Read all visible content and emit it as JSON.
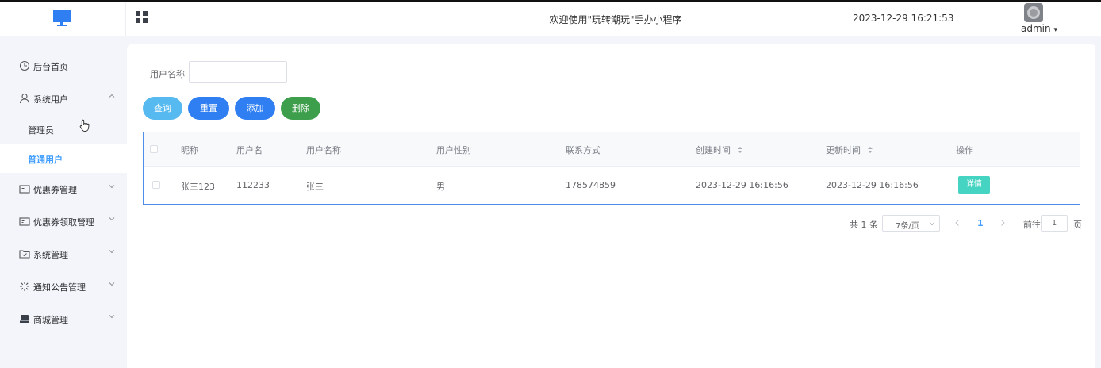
{
  "header": {
    "welcome": "欢迎使用\"玩转潮玩\"手办小程序",
    "datetime": "2023-12-29 16:21:53",
    "user": "admin",
    "user_caret": "▾"
  },
  "sidebar": {
    "items": [
      {
        "label": "后台首页",
        "icon": "clock-icon"
      },
      {
        "label": "系统用户",
        "icon": "user-icon",
        "expanded": true
      },
      {
        "label": "优惠券管理",
        "icon": "coupon-icon"
      },
      {
        "label": "优惠券领取管理",
        "icon": "coupon-icon"
      },
      {
        "label": "系统管理",
        "icon": "folder-check-icon"
      },
      {
        "label": "通知公告管理",
        "icon": "loading-icon"
      },
      {
        "label": "商城管理",
        "icon": "shop-icon"
      }
    ],
    "sub_items": [
      {
        "label": "管理员"
      },
      {
        "label": "普通用户",
        "active": true
      }
    ]
  },
  "filter": {
    "label": "用户名称",
    "value": ""
  },
  "buttons": {
    "query": "查询",
    "reset": "重置",
    "add": "添加",
    "delete": "删除"
  },
  "table": {
    "columns": [
      "昵称",
      "用户名",
      "用户名称",
      "用户性别",
      "联系方式",
      "创建时间",
      "更新时间",
      "操作"
    ],
    "rows": [
      {
        "nickname": "张三123",
        "username": "112233",
        "name": "张三",
        "gender": "男",
        "phone": "178574859",
        "created": "2023-12-29 16:16:56",
        "updated": "2023-12-29 16:16:56",
        "action": "详情"
      }
    ]
  },
  "pagination": {
    "total": "共 1 条",
    "page_size": "7条/页",
    "current": "1",
    "goto_label": "前往",
    "goto_value": "1",
    "page_label": "页"
  },
  "colors": {
    "accent": "#409eff",
    "query_btn": "#56b9ef",
    "primary_btn": "#2f7ff2",
    "danger_btn": "#3d9f4b",
    "detail_btn": "#45d4c1"
  }
}
